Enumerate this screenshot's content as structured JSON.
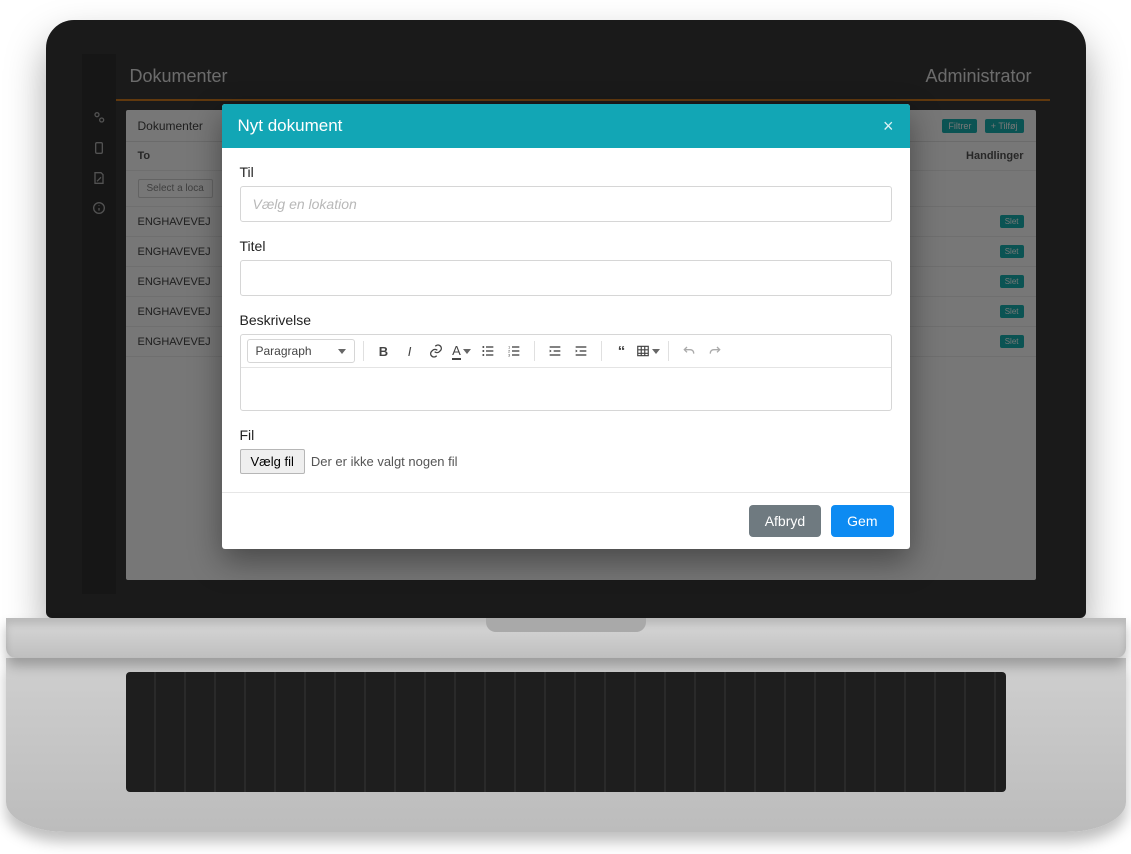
{
  "app": {
    "title": "Dokumenter",
    "user_role": "Administrator",
    "panel_label": "Dokumenter",
    "filters_label": "Filtrer",
    "add_label": "+ Tilføj",
    "columns": {
      "to": "To",
      "actions": "Handlinger"
    },
    "location_selector": "Select a loca",
    "rows": [
      {
        "to": "ENGHAVEVEJ",
        "action": "Slet"
      },
      {
        "to": "ENGHAVEVEJ",
        "action": "Slet"
      },
      {
        "to": "ENGHAVEVEJ",
        "action": "Slet"
      },
      {
        "to": "ENGHAVEVEJ",
        "action": "Slet"
      },
      {
        "to": "ENGHAVEVEJ",
        "action": "Slet"
      }
    ]
  },
  "modal": {
    "title": "Nyt dokument",
    "fields": {
      "to_label": "Til",
      "to_placeholder": "Vælg en lokation",
      "title_label": "Titel",
      "description_label": "Beskrivelse",
      "file_label": "Fil"
    },
    "editor": {
      "style_label": "Paragraph"
    },
    "file": {
      "choose_label": "Vælg fil",
      "none_label": "Der er ikke valgt nogen fil"
    },
    "actions": {
      "cancel": "Afbryd",
      "save": "Gem"
    }
  }
}
